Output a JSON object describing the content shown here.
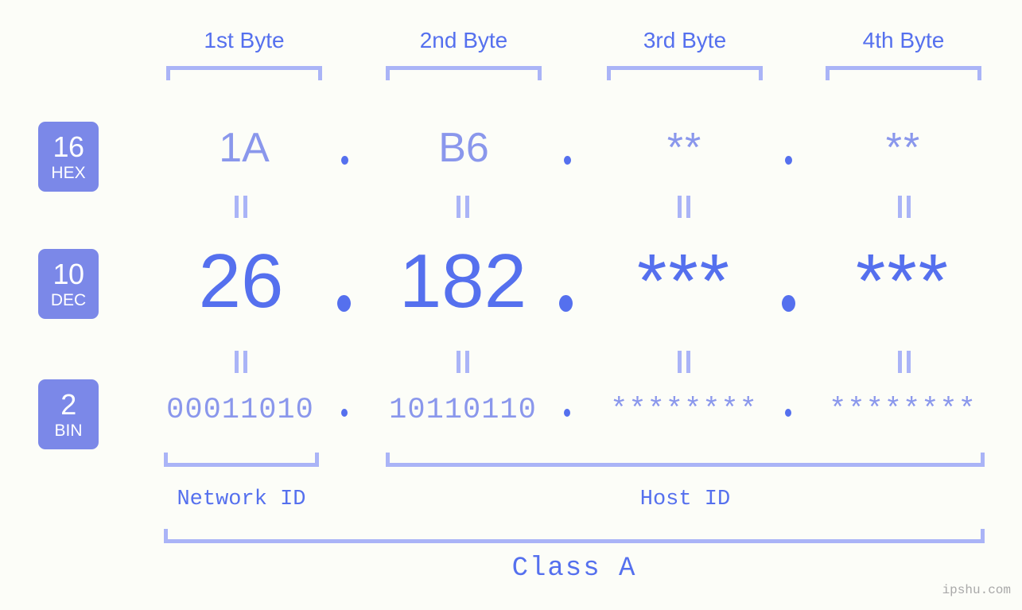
{
  "colors": {
    "background": "#fcfdf8",
    "accent_strong": "#5570ee",
    "accent_light": "#8a97ec",
    "bracket": "#aab4f7",
    "chip_fill": "#7b88e8",
    "chip_text": "#ffffff",
    "watermark": "#a9a9a9"
  },
  "header": {
    "byte_labels": [
      "1st Byte",
      "2nd Byte",
      "3rd Byte",
      "4th Byte"
    ]
  },
  "bases": [
    {
      "number": "16",
      "name": "HEX"
    },
    {
      "number": "10",
      "name": "DEC"
    },
    {
      "number": "2",
      "name": "BIN"
    }
  ],
  "rows": {
    "hex": {
      "base_number": "16",
      "base_name": "HEX",
      "values": [
        "1A",
        "B6",
        "**",
        "**"
      ],
      "separator": "."
    },
    "dec": {
      "base_number": "10",
      "base_name": "DEC",
      "values": [
        "26",
        "182",
        "***",
        "***"
      ],
      "separator": "."
    },
    "bin": {
      "base_number": "2",
      "base_name": "BIN",
      "values": [
        "00011010",
        "10110110",
        "********",
        "********"
      ],
      "separator": "."
    }
  },
  "equality_symbol": "||",
  "footer": {
    "network_id_label": "Network ID",
    "host_id_label": "Host ID",
    "class_label": "Class A"
  },
  "watermark": "ipshu.com"
}
